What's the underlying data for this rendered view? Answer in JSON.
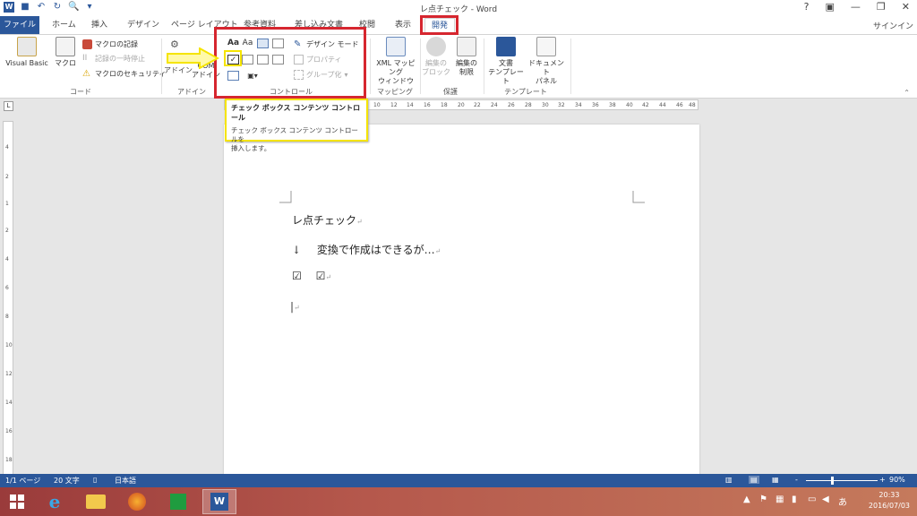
{
  "window": {
    "title": "レ点チェック - Word",
    "help": "?",
    "controls": [
      "▣",
      "—",
      "❐",
      "✕"
    ],
    "signin": "サインイン"
  },
  "tabs": [
    {
      "label": "ファイル",
      "key": "file"
    },
    {
      "label": "ホーム"
    },
    {
      "label": "挿入"
    },
    {
      "label": "デザイン"
    },
    {
      "label": "ページ レイアウト"
    },
    {
      "label": "参考資料"
    },
    {
      "label": "差し込み文書"
    },
    {
      "label": "校閲"
    },
    {
      "label": "表示"
    },
    {
      "label": "開発",
      "active": true
    }
  ],
  "ribbon": {
    "code": {
      "label": "コード",
      "visual_basic": "Visual Basic",
      "macro": "マクロ",
      "record": "マクロの記録",
      "pause": "記録の一時停止",
      "security": "マクロのセキュリティ"
    },
    "addins": {
      "label": "アドイン",
      "addin": "アドイン",
      "com": "COM",
      "com_addin": "アドイン"
    },
    "controls": {
      "label": "コントロール",
      "design_mode": "デザイン モード",
      "properties": "プロパティ",
      "group": "グループ化"
    },
    "mapping": {
      "label": "マッピング",
      "xml_line1": "XML マッピング",
      "xml_line2": "ウィンドウ"
    },
    "protect": {
      "label": "保護",
      "block_line1": "編集の",
      "block_line2": "ブロック",
      "restrict_line1": "編集の",
      "restrict_line2": "制限"
    },
    "templates": {
      "label": "テンプレート",
      "doc_line1": "文書",
      "doc_line2": "テンプレート",
      "panel_line1": "ドキュメント",
      "panel_line2": "パネル"
    }
  },
  "tooltip": {
    "title": "チェック ボックス コンテンツ コントロール",
    "desc_line1": "チェック ボックス コンテンツ コントロールを",
    "desc_line2": "挿入します。"
  },
  "ruler": {
    "tab_selector": "L",
    "marks": [
      "10",
      "12",
      "14",
      "16",
      "18",
      "20",
      "22",
      "24",
      "26",
      "28",
      "30",
      "32",
      "34",
      "36",
      "38",
      "40",
      "42",
      "44",
      "46",
      "48"
    ],
    "vmarks": [
      "4",
      "2",
      "1",
      "2",
      "4",
      "6",
      "8",
      "10",
      "12",
      "14",
      "16",
      "18"
    ]
  },
  "document": {
    "line1": "レ点チェック",
    "arrow": "↓",
    "line2": "変換で作成はできるが…",
    "check1": "☑",
    "check2": "☑",
    "pilcrow": "↵"
  },
  "status": {
    "page": "1/1 ページ",
    "words": "20 文字",
    "lang": "日本語",
    "zoom_minus": "-",
    "zoom_plus": "+",
    "zoom": "90%",
    "zoom_fraction": 0.55
  },
  "taskbar": {
    "time": "20:33",
    "date": "2016/07/03",
    "ime": "あ"
  },
  "colors": {
    "accent": "#2b579a",
    "highlight_red": "#d6262f",
    "highlight_yellow": "#f5e400"
  }
}
